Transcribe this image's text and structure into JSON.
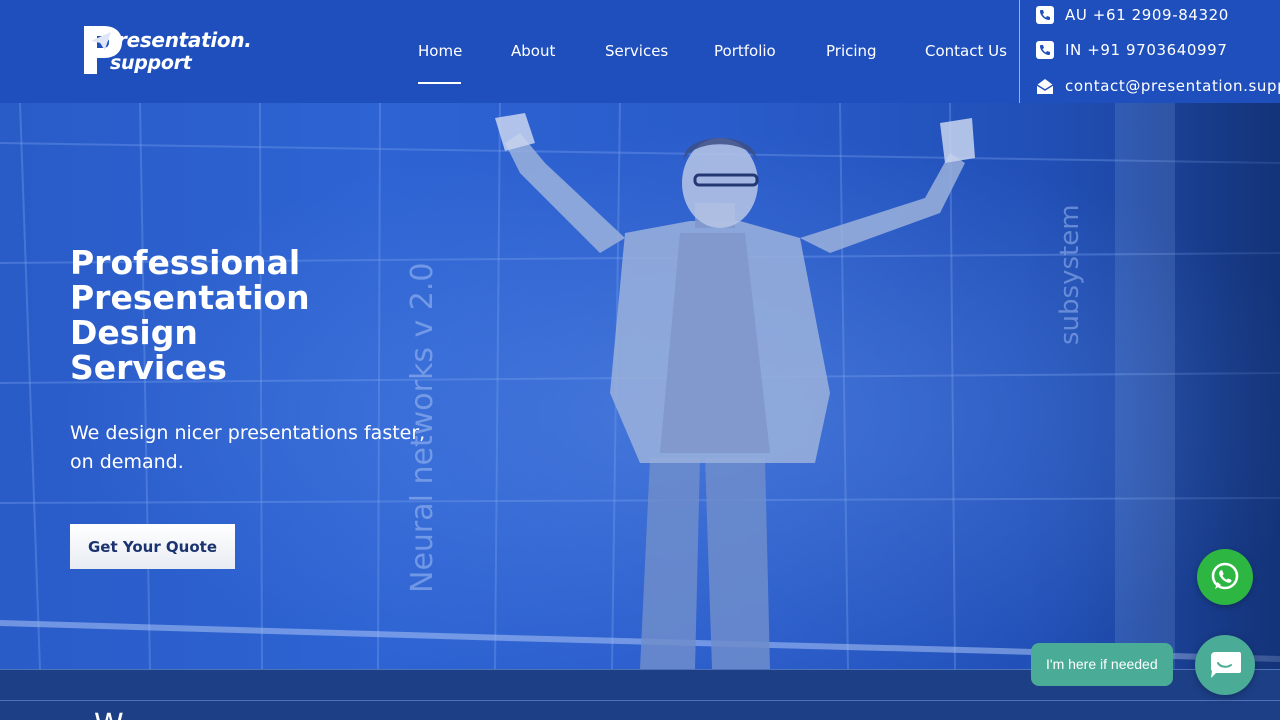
{
  "brand": {
    "logo_line1": "resentation.",
    "logo_line2": "support"
  },
  "nav": {
    "items": [
      {
        "label": "Home",
        "active": true
      },
      {
        "label": "About"
      },
      {
        "label": "Services"
      },
      {
        "label": "Portfolio"
      },
      {
        "label": "Pricing"
      },
      {
        "label": "Contact Us"
      }
    ]
  },
  "contact": {
    "phone_au": "AU +61 2909-84320",
    "phone_in": "IN +91 9703640997",
    "email": "contact@presentation.support"
  },
  "hero": {
    "title_lines": [
      "Professional",
      "Presentation",
      "Design",
      "Services"
    ],
    "subtitle": "We design nicer presentations faster, on demand.",
    "cta_label": "Get Your Quote",
    "backdrop_text_left": "Neural networks v 2.0",
    "backdrop_text_right": "subsystem"
  },
  "below": {
    "heading_fragment": "W"
  },
  "widgets": {
    "chat_prompt": "I'm here if needed"
  },
  "colors": {
    "header_bg": "#1f4fbd",
    "hero_blue": "#2d63d3",
    "whatsapp_green": "#2db742",
    "chat_teal": "#4aac97",
    "cta_text": "#1b3470"
  },
  "icons": [
    "paper-plane-icon",
    "phone-icon",
    "email-icon",
    "whatsapp-icon",
    "chat-icon"
  ]
}
